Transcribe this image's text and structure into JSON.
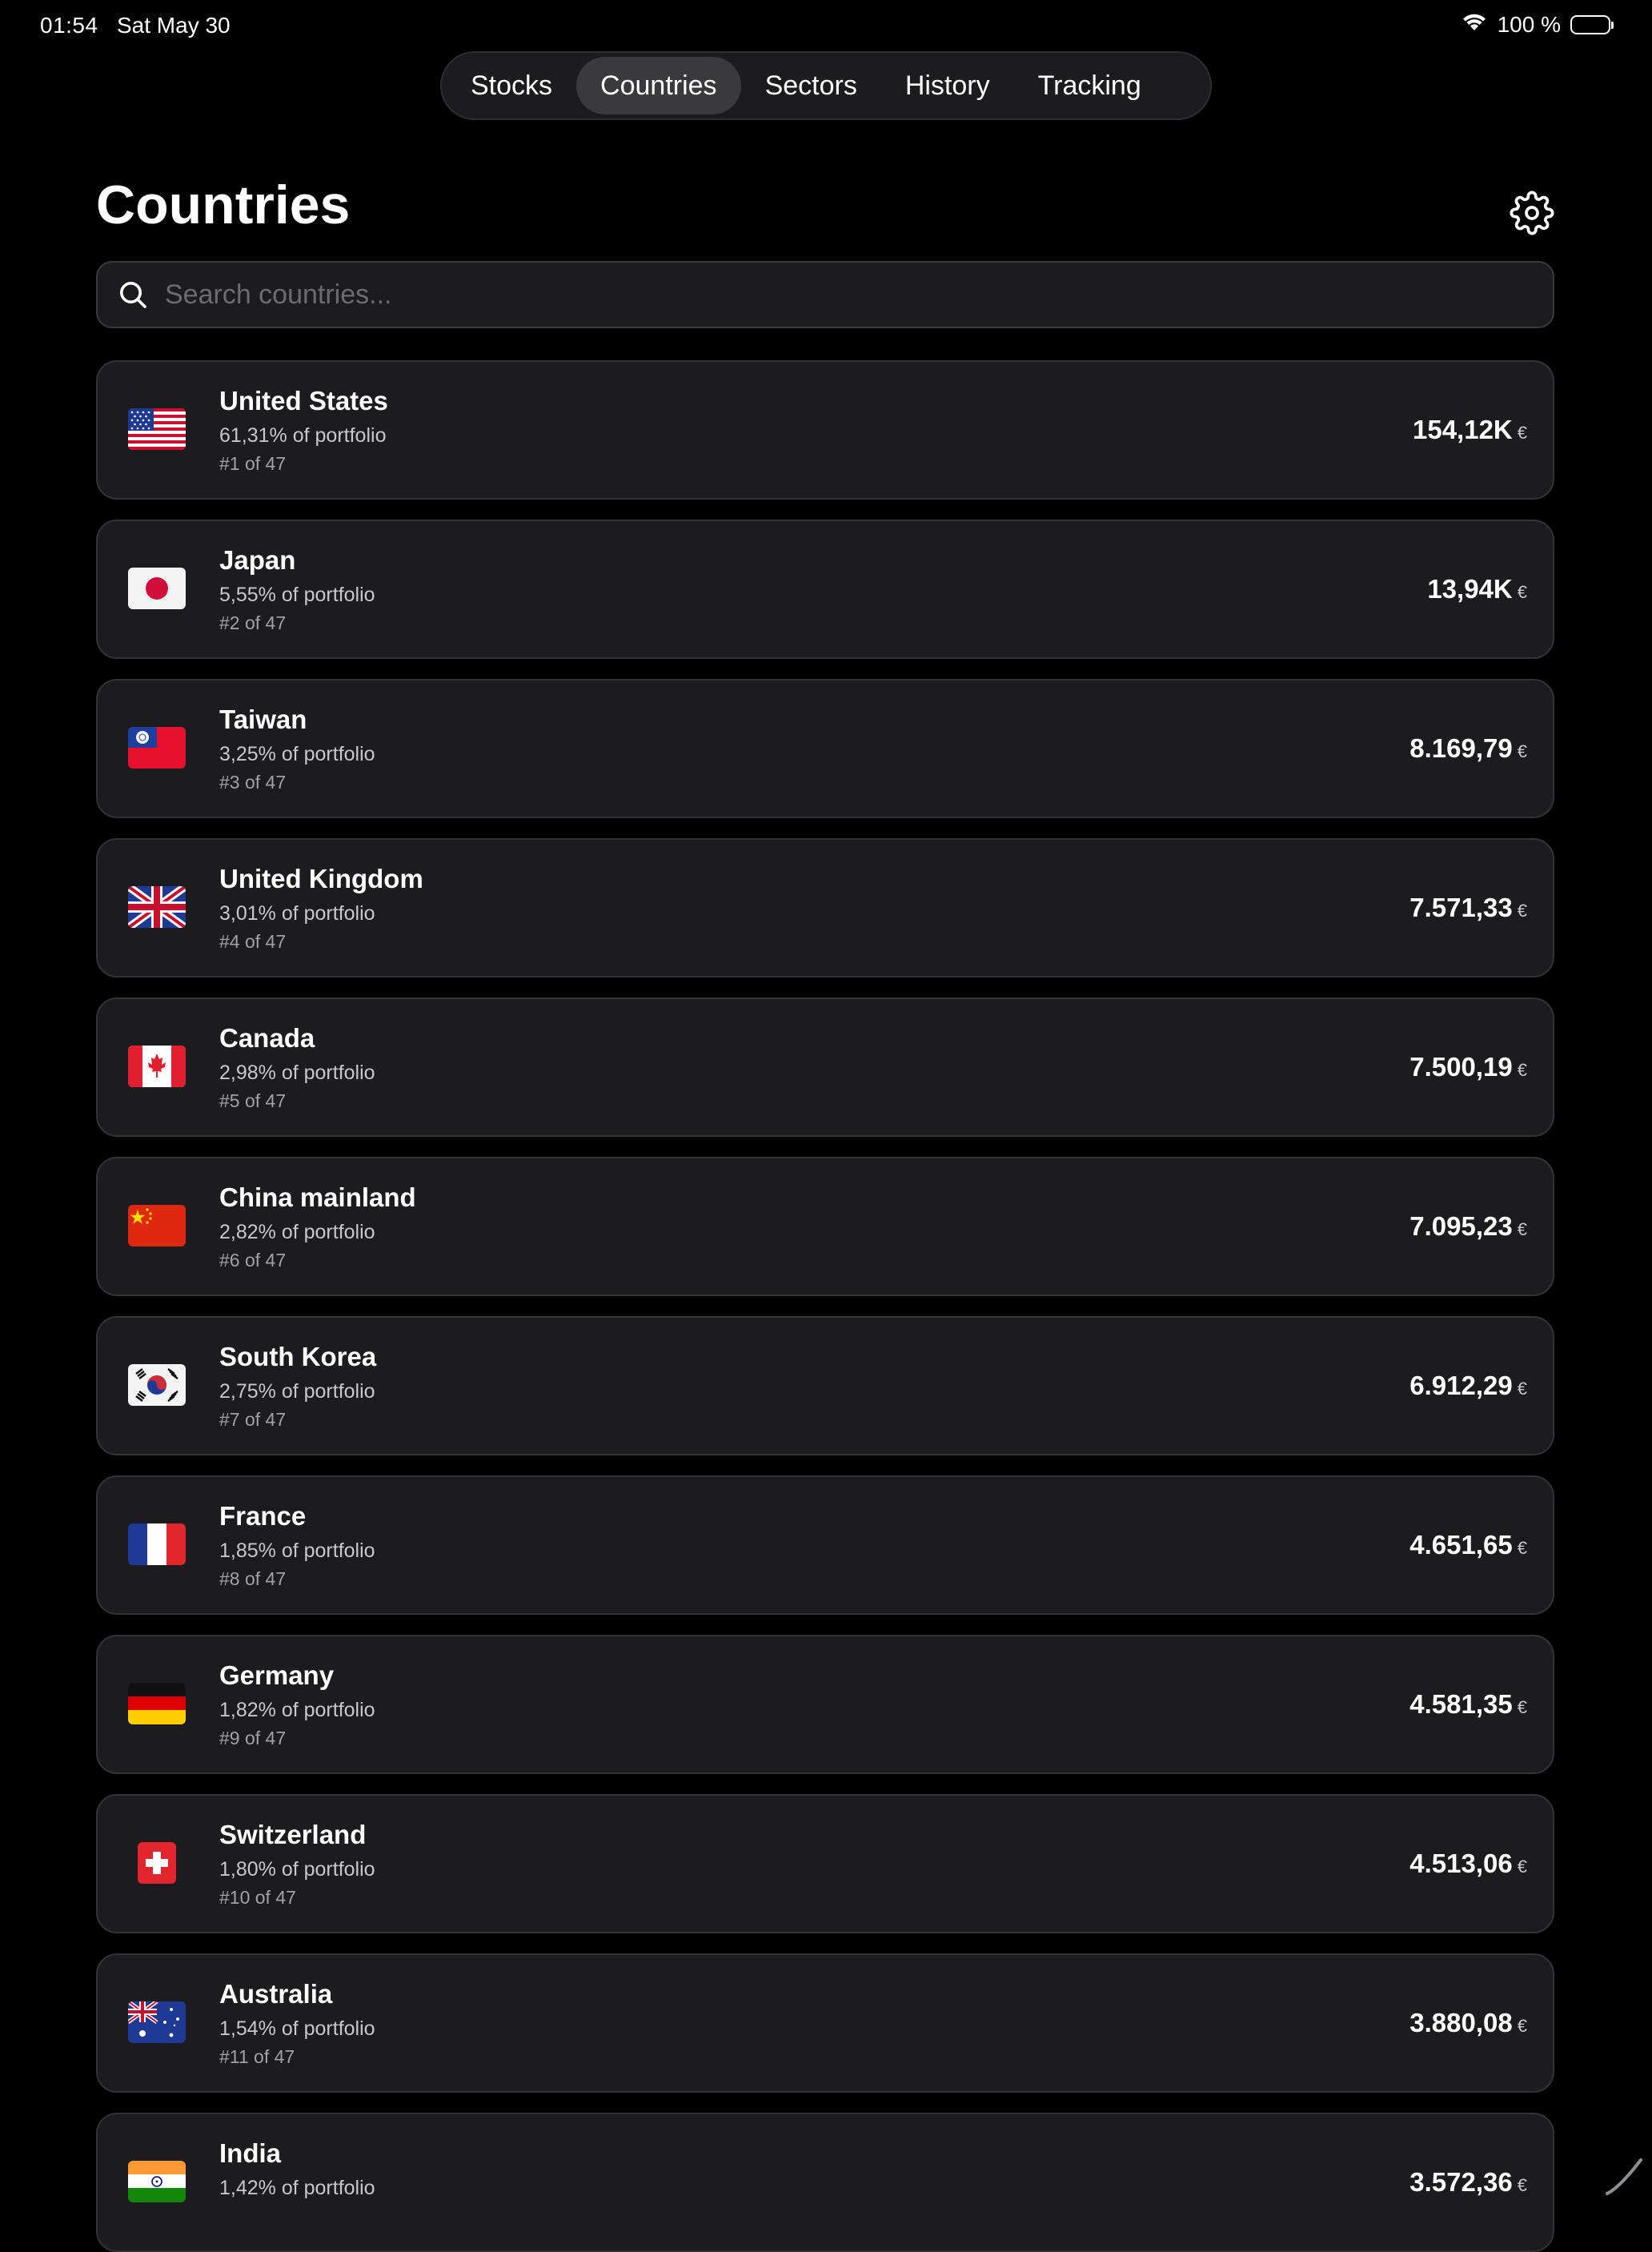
{
  "status_bar": {
    "time": "01:54",
    "date": "Sat May 30",
    "battery": "100 %"
  },
  "tabs": [
    {
      "label": "Stocks",
      "active": false
    },
    {
      "label": "Countries",
      "active": true
    },
    {
      "label": "Sectors",
      "active": false
    },
    {
      "label": "History",
      "active": false
    },
    {
      "label": "Tracking",
      "active": false
    }
  ],
  "header": {
    "title": "Countries",
    "settings_icon": "gear-icon"
  },
  "search": {
    "placeholder": "Search countries...",
    "value": ""
  },
  "countries": [
    {
      "name": "United States",
      "share": "61,31% of portfolio",
      "rank": "#1 of 47",
      "value": "154,12K",
      "currency": "€",
      "flag": "us"
    },
    {
      "name": "Japan",
      "share": "5,55% of portfolio",
      "rank": "#2 of 47",
      "value": "13,94K",
      "currency": "€",
      "flag": "jp"
    },
    {
      "name": "Taiwan",
      "share": "3,25% of portfolio",
      "rank": "#3 of 47",
      "value": "8.169,79",
      "currency": "€",
      "flag": "tw"
    },
    {
      "name": "United Kingdom",
      "share": "3,01% of portfolio",
      "rank": "#4 of 47",
      "value": "7.571,33",
      "currency": "€",
      "flag": "gb"
    },
    {
      "name": "Canada",
      "share": "2,98% of portfolio",
      "rank": "#5 of 47",
      "value": "7.500,19",
      "currency": "€",
      "flag": "ca"
    },
    {
      "name": "China mainland",
      "share": "2,82% of portfolio",
      "rank": "#6 of 47",
      "value": "7.095,23",
      "currency": "€",
      "flag": "cn"
    },
    {
      "name": "South Korea",
      "share": "2,75% of portfolio",
      "rank": "#7 of 47",
      "value": "6.912,29",
      "currency": "€",
      "flag": "kr"
    },
    {
      "name": "France",
      "share": "1,85% of portfolio",
      "rank": "#8 of 47",
      "value": "4.651,65",
      "currency": "€",
      "flag": "fr"
    },
    {
      "name": "Germany",
      "share": "1,82% of portfolio",
      "rank": "#9 of 47",
      "value": "4.581,35",
      "currency": "€",
      "flag": "de"
    },
    {
      "name": "Switzerland",
      "share": "1,80% of portfolio",
      "rank": "#10 of 47",
      "value": "4.513,06",
      "currency": "€",
      "flag": "ch"
    },
    {
      "name": "Australia",
      "share": "1,54% of portfolio",
      "rank": "#11 of 47",
      "value": "3.880,08",
      "currency": "€",
      "flag": "au"
    },
    {
      "name": "India",
      "share": "1,42% of portfolio",
      "rank": "",
      "value": "3.572,36",
      "currency": "€",
      "flag": "in"
    }
  ]
}
